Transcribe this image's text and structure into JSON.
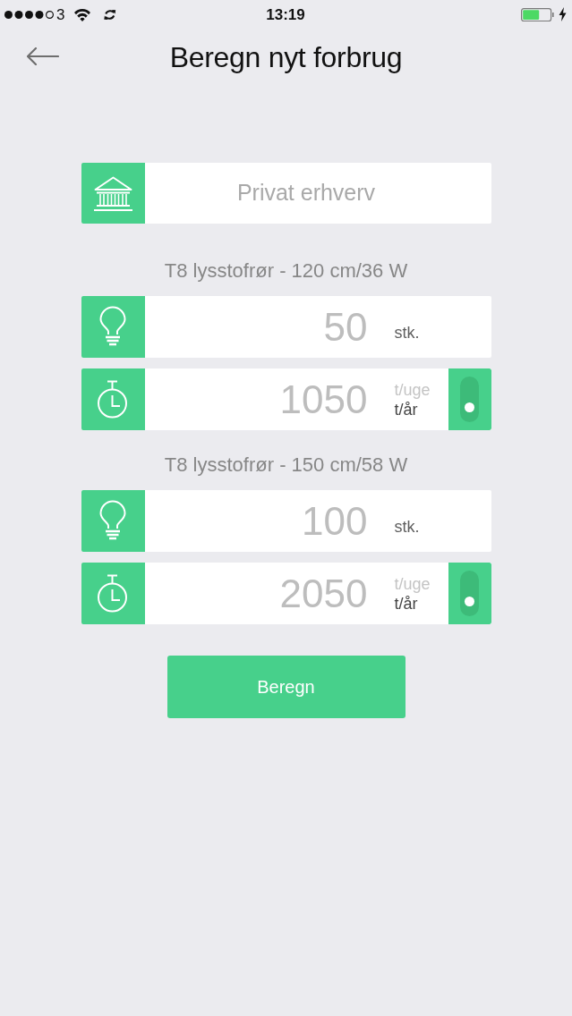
{
  "status_bar": {
    "carrier": "3",
    "time": "13:19"
  },
  "header": {
    "title": "Beregn nyt forbrug"
  },
  "sector": {
    "label": "Privat erhverv"
  },
  "groups": [
    {
      "label": "T8 lysstofrør - 120 cm/36 W",
      "count": {
        "value": "50",
        "unit": "stk."
      },
      "hours": {
        "value": "1050",
        "units": [
          {
            "label": "t/uge",
            "selected": false
          },
          {
            "label": "t/år",
            "selected": true
          }
        ]
      }
    },
    {
      "label": "T8 lysstofrør - 150 cm/58 W",
      "count": {
        "value": "100",
        "unit": "stk."
      },
      "hours": {
        "value": "2050",
        "units": [
          {
            "label": "t/uge",
            "selected": false
          },
          {
            "label": "t/år",
            "selected": true
          }
        ]
      }
    }
  ],
  "button": {
    "label": "Beregn"
  }
}
